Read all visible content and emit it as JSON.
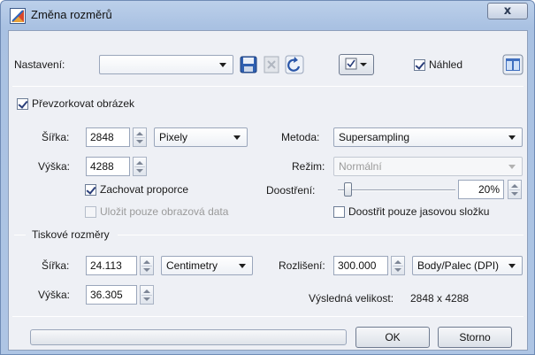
{
  "window": {
    "title": "Změna rozměrů",
    "close_glyph": "x"
  },
  "toolbar": {
    "preset_label": "Nastavení:",
    "preset_value": "",
    "preview_label": "Náhled",
    "preview_checked": true
  },
  "resample": {
    "label": "Převzorkovat obrázek",
    "checked": true,
    "width_label": "Šířka:",
    "width_value": "2848",
    "height_label": "Výška:",
    "height_value": "4288",
    "unit_value": "Pixely",
    "keep_ratio_label": "Zachovat proporce",
    "keep_ratio_checked": true,
    "save_only_label": "Uložit pouze obrazová data",
    "method_label": "Metoda:",
    "method_value": "Supersampling",
    "mode_label": "Režim:",
    "mode_value": "Normální",
    "sharpen_label": "Doostření:",
    "sharpen_value": "20%",
    "sharpen_fraction": 0.08,
    "sharpen_luma_label": "Doostřit pouze jasovou složku"
  },
  "print": {
    "section_label": "Tiskové rozměry",
    "width_label": "Šířka:",
    "width_value": "24.113",
    "height_label": "Výška:",
    "height_value": "36.305",
    "unit_value": "Centimetry",
    "resolution_label": "Rozlišení:",
    "resolution_value": "300.000",
    "resolution_unit": "Body/Palec (DPI)",
    "result_label": "Výsledná velikost:",
    "result_value": "2848 x 4288"
  },
  "footer": {
    "ok_label": "OK",
    "cancel_label": "Storno"
  },
  "colors": {
    "title_gradient_top": "#bcd0ea",
    "client_bg": "#eef0f5",
    "check_mark": "#2a3e7a"
  }
}
